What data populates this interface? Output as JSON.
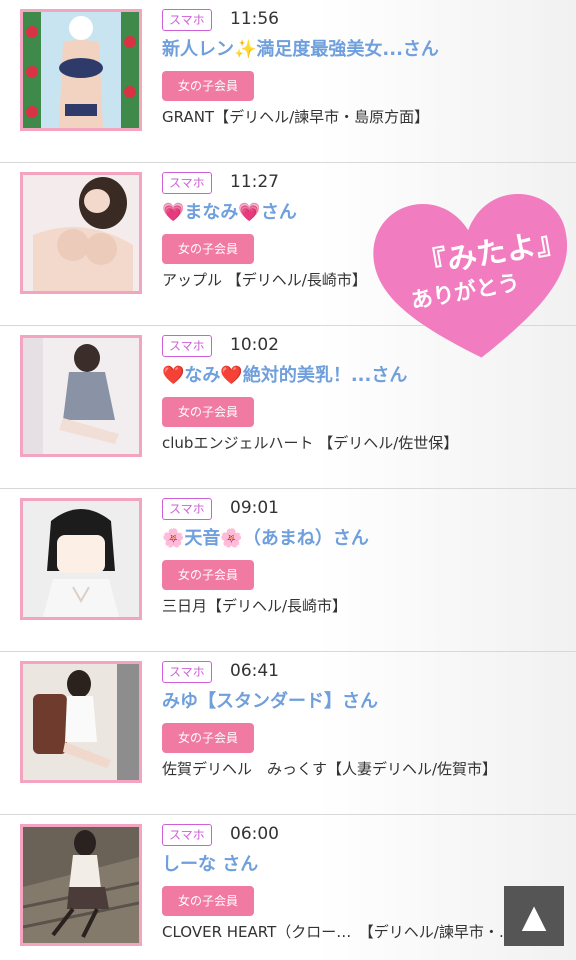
{
  "entries": [
    {
      "device": "スマホ",
      "time": "11:56",
      "name": "新人レン✨満足度最強美女...さん",
      "member_label": "女の子会員",
      "shop": "GRANT【デリヘル/諫早市・島原方面】"
    },
    {
      "device": "スマホ",
      "time": "11:27",
      "name": "💗まなみ💗さん",
      "member_label": "女の子会員",
      "shop": "アップル 【デリヘル/長崎市】"
    },
    {
      "device": "スマホ",
      "time": "10:02",
      "name": "❤️なみ❤️絶対的美乳！...さん",
      "member_label": "女の子会員",
      "shop": "clubエンジェルハート 【デリヘル/佐世保】"
    },
    {
      "device": "スマホ",
      "time": "09:01",
      "name": "🌸天音🌸（あまね）さん",
      "member_label": "女の子会員",
      "shop": "三日月【デリヘル/長崎市】"
    },
    {
      "device": "スマホ",
      "time": "06:41",
      "name": "みゆ【スタンダード】さん",
      "member_label": "女の子会員",
      "shop": "佐賀デリヘル　みっくす【人妻デリヘル/佐賀市】"
    },
    {
      "device": "スマホ",
      "time": "06:00",
      "name": "しーな さん",
      "member_label": "女の子会員",
      "shop": "CLOVER HEART（クロー…　【デリヘル/諫早市・…"
    }
  ],
  "stamp": {
    "line1": "『みたよ』",
    "line2": "ありがとう"
  },
  "top_button": {
    "icon": "triangle-up-icon",
    "label": "▲"
  },
  "colors": {
    "accent_pink": "#f07aa1",
    "name_blue": "#6f9fdc",
    "badge_purple": "#cf5fd8",
    "thumb_border": "#f3a4c0",
    "stamp_pink": "#f27cc0"
  }
}
